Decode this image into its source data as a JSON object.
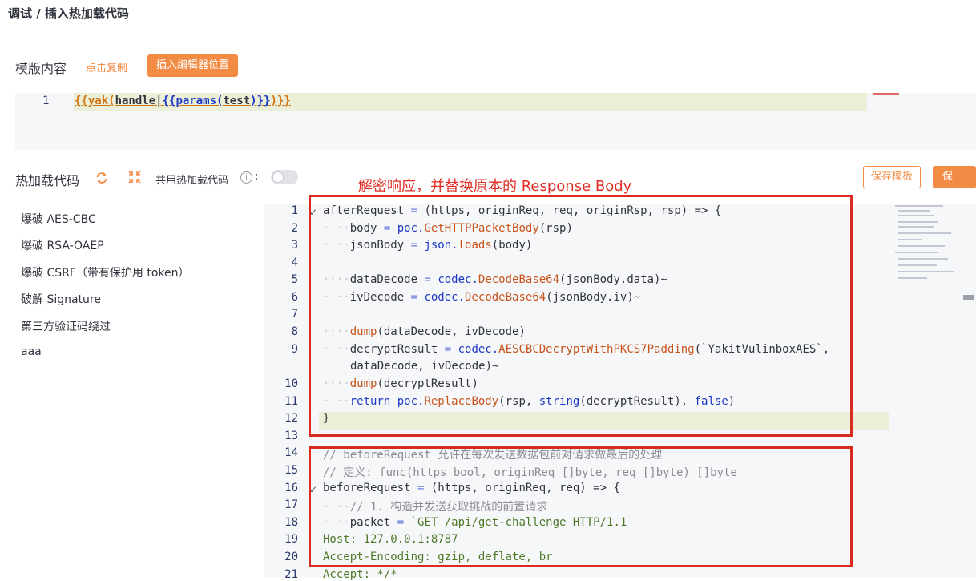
{
  "breadcrumb": "调试 / 插入热加载代码",
  "template": {
    "label": "模版内容",
    "copy_link": "点击复制",
    "insert_button": "插入编辑器位置",
    "line_number": "1",
    "code": {
      "p1": "{{yak(",
      "p2": "handle|",
      "p3": "{{params(",
      "p4": "test",
      "p5": ")}}",
      "p6": ")}}"
    }
  },
  "hotload": {
    "label": "热加载代码",
    "shared_label": "共用热加载代码",
    "info_icon": "i",
    "colon": ":",
    "shared_enabled": false,
    "save_template_button": "保存模板",
    "save_button": "保 存"
  },
  "annotation": "解密响应，并替换原本的 Response Body",
  "sidebar": {
    "items": [
      {
        "label": "爆破 AES-CBC"
      },
      {
        "label": "爆破 RSA-OAEP"
      },
      {
        "label": "爆破 CSRF（带有保护用 token）"
      },
      {
        "label": "破解 Signature"
      },
      {
        "label": "第三方验证码绕过"
      },
      {
        "label": "aaa"
      }
    ]
  },
  "editor": {
    "line_numbers": [
      "1",
      "2",
      "3",
      "4",
      "5",
      "6",
      "7",
      "8",
      "9",
      "",
      "10",
      "11",
      "12",
      "13",
      "14",
      "15",
      "16",
      "17",
      "18",
      "19",
      "20",
      "21"
    ],
    "lines": {
      "l1": {
        "a": "afterRequest",
        "b": " = ",
        "c": "(https, originReq, req, originRsp, rsp) => {"
      },
      "l2": {
        "ind": "····",
        "a": "body",
        "b": " = ",
        "c": "poc.",
        "d": "GetHTTPPacketBody",
        "e": "(rsp)"
      },
      "l3": {
        "ind": "····",
        "a": "jsonBody",
        "b": " = ",
        "c": "json.",
        "d": "loads",
        "e": "(body)"
      },
      "l5": {
        "ind": "····",
        "a": "dataDecode",
        "b": " = ",
        "c": "codec.",
        "d": "DecodeBase64",
        "e": "(jsonBody.data)~"
      },
      "l6": {
        "ind": "····",
        "a": "ivDecode",
        "b": " = ",
        "c": "codec.",
        "d": "DecodeBase64",
        "e": "(jsonBody.iv)~"
      },
      "l8": {
        "ind": "····",
        "d": "dump",
        "e": "(dataDecode, ivDecode)"
      },
      "l9": {
        "ind": "····",
        "a": "decryptResult",
        "b": " = ",
        "c": "codec.",
        "d": "AESCBCDecryptWithPKCS7Padding",
        "e": "(`YakitVulinboxAES`,"
      },
      "l9b": {
        "ind": "",
        "e": "dataDecode, ivDecode)~"
      },
      "l10": {
        "ind": "····",
        "d": "dump",
        "e": "(decryptResult)"
      },
      "l11": {
        "ind": "····",
        "k": "return",
        "c": " poc.",
        "d": "ReplaceBody",
        "e": "(rsp, ",
        "k2": "string",
        "e2": "(decryptResult), ",
        "k3": "false",
        "e3": ")"
      },
      "l12": {
        "e": "}"
      },
      "l14": {
        "cm": "// beforeRequest 允许在每次发送数据包前对请求做最后的处理"
      },
      "l15": {
        "cm": "// 定义: func(https bool, originReq []byte, req []byte) []byte"
      },
      "l16": {
        "a": "beforeRequest",
        "b": " = ",
        "c": "(https, originReq, req) => {"
      },
      "l17": {
        "ind": "····",
        "cm": "// 1. 构造并发送获取挑战的前置请求"
      },
      "l18": {
        "ind": "····",
        "a": "packet",
        "b": " = ",
        "str": "`GET /api/get-challenge HTTP/1.1"
      },
      "l19": {
        "str": "Host: 127.0.0.1:8787"
      },
      "l20": {
        "str": "Accept-Encoding: gzip, deflate, br"
      },
      "l21": {
        "str": "Accept: */*"
      }
    }
  },
  "colors": {
    "accent": "#f28b44",
    "annotation_red": "#e02e24",
    "line_highlight": "#ebefd8",
    "editor_bg": "#f6f7f9"
  }
}
